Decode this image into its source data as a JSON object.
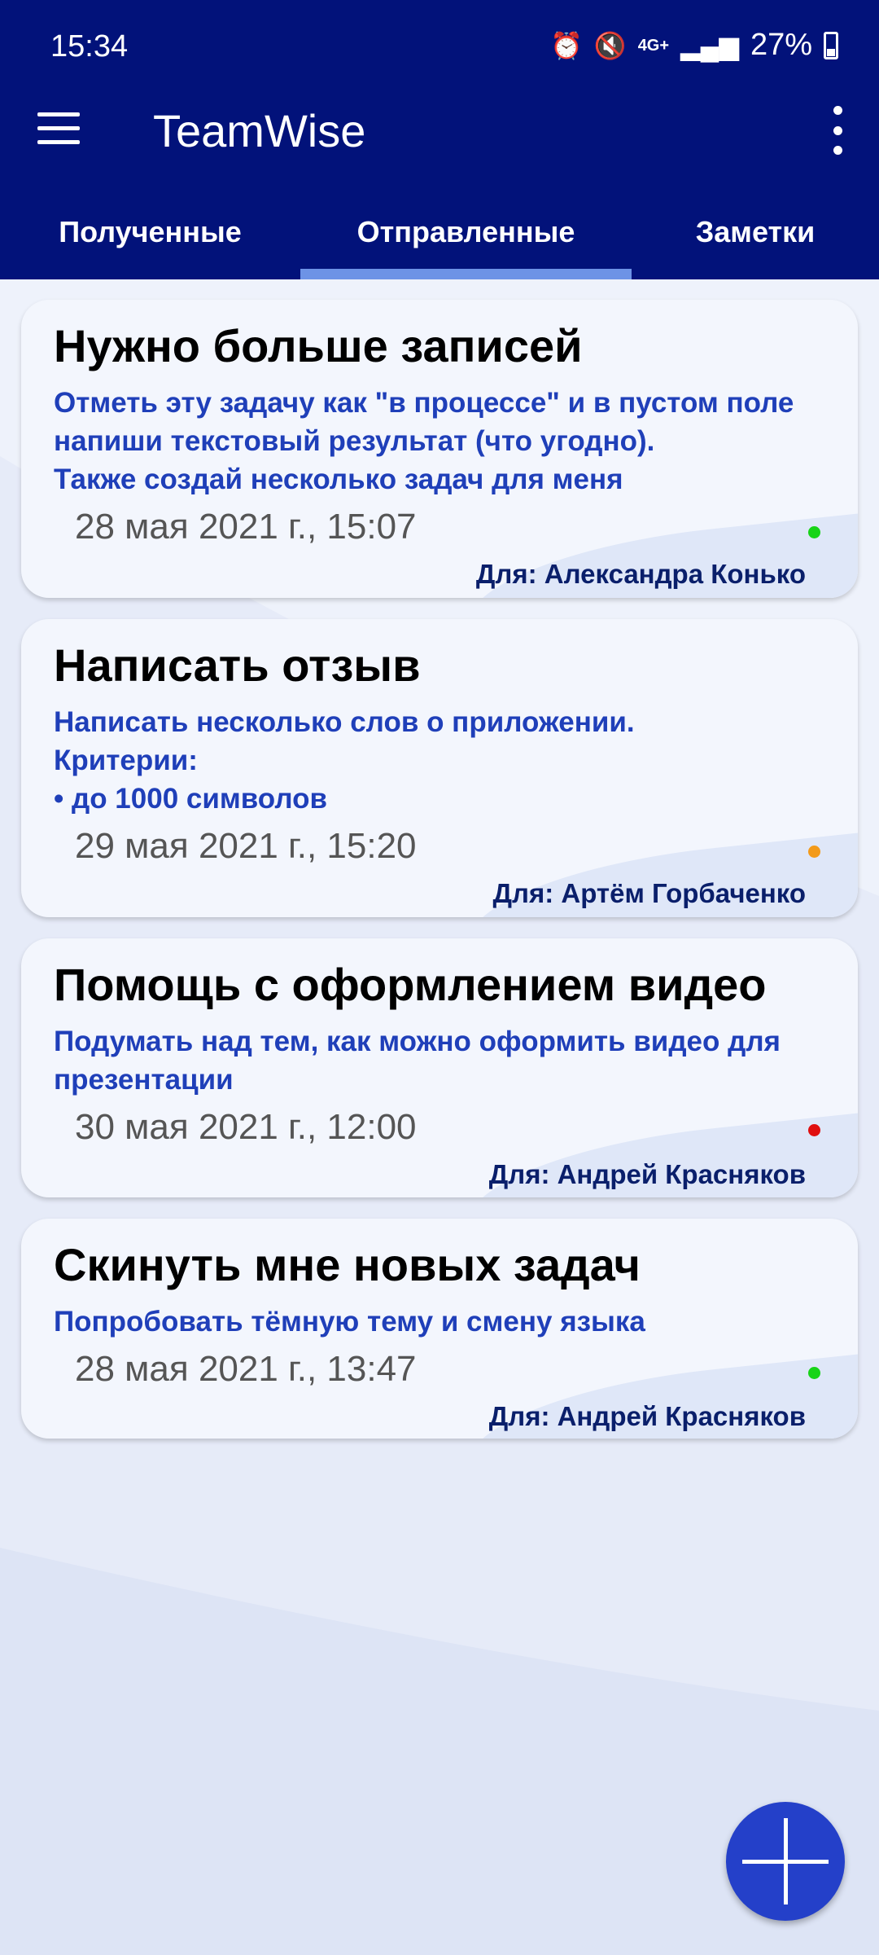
{
  "status_bar": {
    "time": "15:34",
    "battery": "27%",
    "icons": [
      "alarm-icon",
      "mute-icon",
      "4g-icon",
      "signal-icon",
      "battery-icon"
    ]
  },
  "app_bar": {
    "title": "TeamWise",
    "color": "#02127a"
  },
  "tabs": [
    {
      "label": "Полученные",
      "selected": false
    },
    {
      "label": "Отправленные",
      "selected": true
    },
    {
      "label": "Заметки",
      "selected": false
    }
  ],
  "tasks": [
    {
      "title": "Нужно больше записей",
      "description": "Отметь эту задачу как \"в процессе\" и в пустом поле\nнапиши текстовый результат (что угодно).\nТакже создай несколько задач для меня",
      "date": "28 мая 2021 г., 15:07",
      "assignee": "Для: Александра Конько",
      "status_color": "#17d417"
    },
    {
      "title": "Написать отзыв",
      "description": "Написать несколько слов о приложении.\nКритерии:\n• до 1000 символов",
      "date": "29 мая 2021 г., 15:20",
      "assignee": "Для: Артём Горбаченко",
      "status_color": "#f39a1a"
    },
    {
      "title": "Помощь с оформлением видео",
      "description": "Подумать над тем, как можно оформить видео для\nпрезентации",
      "date": "30 мая 2021 г., 12:00",
      "assignee": "Для: Андрей Красняков",
      "status_color": "#e00f0f"
    },
    {
      "title": "Скинуть мне новых задач",
      "description": "Попробовать тёмную тему и смену языка",
      "date": "28 мая 2021 г., 13:47",
      "assignee": "Для: Андрей Красняков",
      "status_color": "#17d417"
    }
  ],
  "fab": {
    "icon": "plus-icon"
  }
}
